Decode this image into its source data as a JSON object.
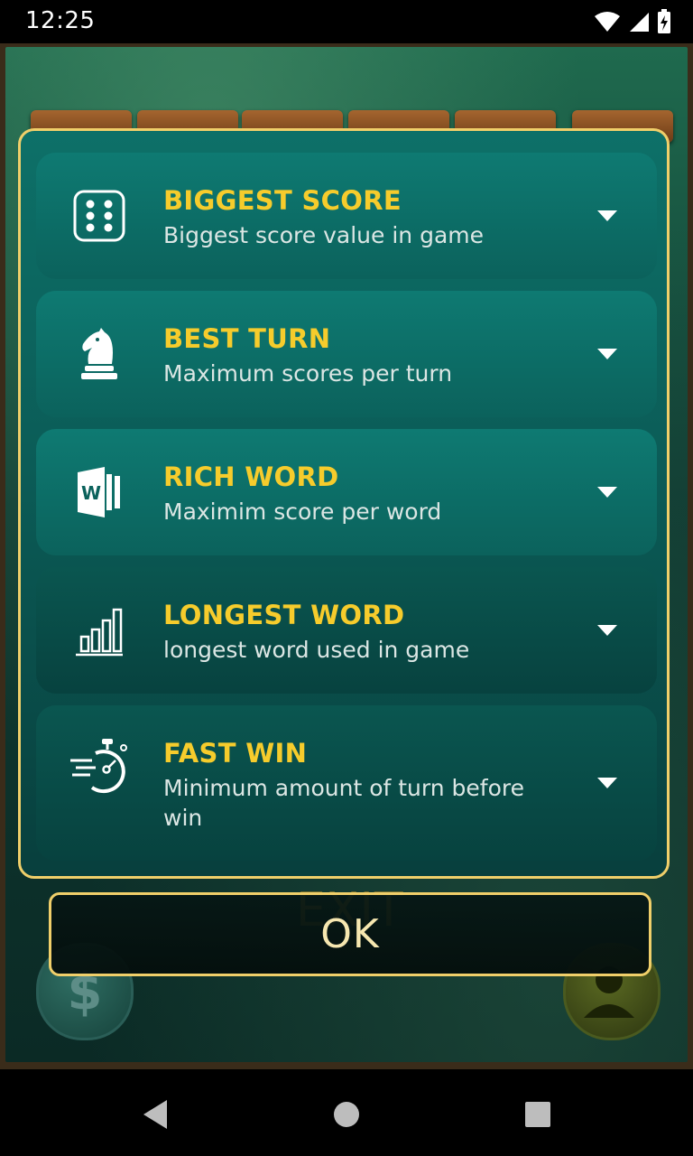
{
  "status_bar": {
    "time": "12:25"
  },
  "background": {
    "exit_label": "EXIT"
  },
  "dialog": {
    "stats": [
      {
        "title": "BIGGEST SCORE",
        "subtitle": "Biggest score value in game",
        "icon": "dice-icon"
      },
      {
        "title": "BEST TURN",
        "subtitle": "Maximum scores per turn",
        "icon": "chess-knight-icon"
      },
      {
        "title": "RICH WORD",
        "subtitle": "Maximim score per word",
        "icon": "word-document-icon"
      },
      {
        "title": "LONGEST WORD",
        "subtitle": "longest word used in game",
        "icon": "bar-chart-icon"
      },
      {
        "title": "FAST WIN",
        "subtitle": "Minimum amount of turn before win",
        "icon": "stopwatch-icon"
      }
    ]
  },
  "ok_button": {
    "label": "OK"
  },
  "colors": {
    "title_yellow": "#f6cc2c",
    "dialog_border": "#f0cf6a",
    "card_teal": "#0e7a72"
  }
}
